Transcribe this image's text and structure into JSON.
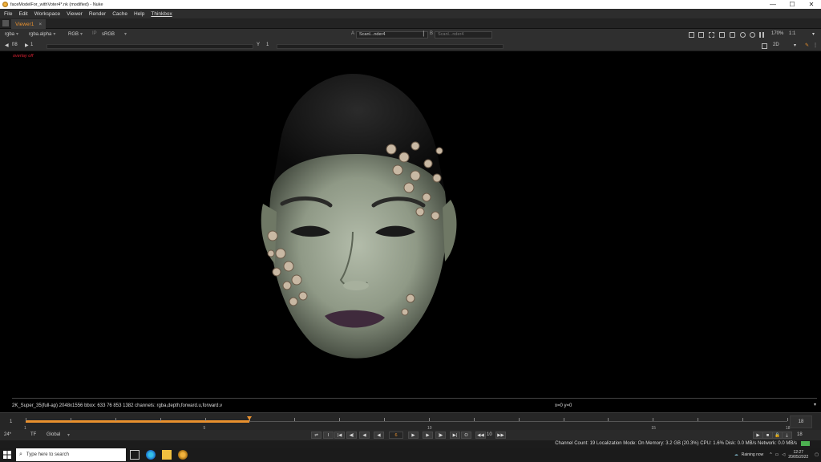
{
  "window": {
    "title": "faceModelFor_withVoter4*.nk (modified) - Nuke",
    "controls": [
      "—",
      "☐",
      "✕"
    ]
  },
  "menu": [
    "File",
    "Edit",
    "Workspace",
    "Viewer",
    "Render",
    "Cache",
    "Help",
    "Thinkbox"
  ],
  "tab": {
    "label": "Viewer1",
    "close": "×"
  },
  "toolbar": {
    "layer": "rgba",
    "channel": "rgba.alpha",
    "display": "RGB",
    "ip": "IP",
    "lut": "sRGB",
    "input_a_letter": "A",
    "input_a": "Scanl...nder4",
    "input_b_letter": "B",
    "input_b": "Scanl...nder4",
    "zoom": "170%",
    "ratio": "1:1",
    "fstop": "f/8",
    "frame_step": "1",
    "y_label": "Y",
    "y_value": "1",
    "view_mode": "2D"
  },
  "viewer": {
    "overlay_label": "overlay off",
    "info": "2K_Super_35(full-ap) 2048x1556  bbox: 633 76 853 1382 channels: rgba,depth,forward.u,forward.v",
    "coords": "x=0 y=0"
  },
  "timeline": {
    "start": "1",
    "end": "18",
    "current": 6,
    "tick_labels": [
      "1",
      "5",
      "10",
      "15",
      "18"
    ]
  },
  "playback": {
    "fps": "24*",
    "tf": "TF",
    "range": "Global",
    "frame": "6",
    "step": "10",
    "end_frame": "18"
  },
  "status": {
    "text": "Channel Count: 19  Localization Mode: On  Memory: 3.2 GB (20.3%)  CPU: 1.6%  Disk: 0.0 MB/s  Network: 0.0 MB/s"
  },
  "taskbar": {
    "search_placeholder": "Type here to search",
    "weather": "Raining now",
    "time": "12:27",
    "date": "20/05/2022"
  }
}
